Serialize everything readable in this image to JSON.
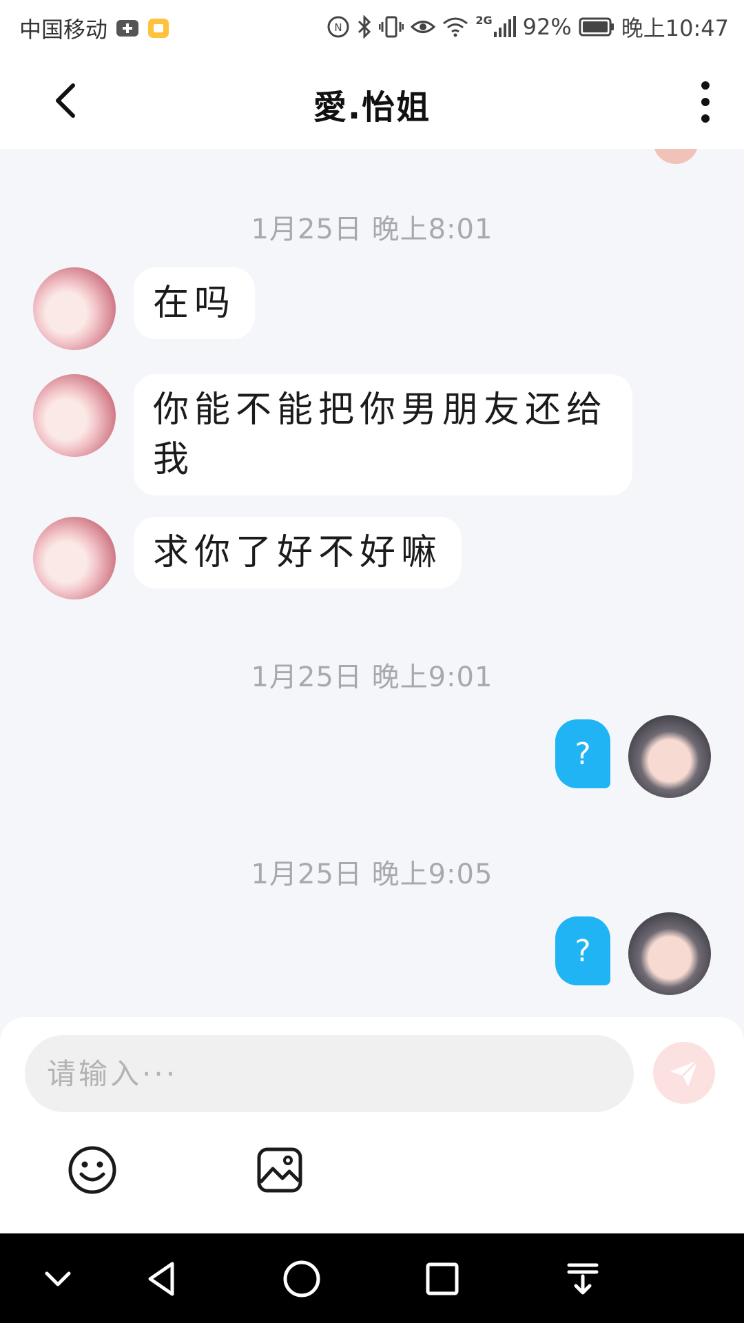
{
  "status_bar": {
    "carrier": "中国移动",
    "network": "2G",
    "battery": "92%",
    "time": "晚上10:47"
  },
  "header": {
    "title": "愛.怡姐"
  },
  "messages": {
    "timestamp_1": "1月25日 晚上8:01",
    "msg_1": "在吗",
    "msg_2": "你能不能把你男朋友还给我",
    "msg_3": "求你了好不好嘛",
    "timestamp_2": "1月25日 晚上9:01",
    "reply_1": "?",
    "timestamp_3": "1月25日 晚上9:05",
    "reply_2": "?"
  },
  "input": {
    "placeholder": "请输入···"
  },
  "colors": {
    "outgoing_bubble": "#20b4f5",
    "incoming_bubble": "#ffffff",
    "send_button": "#fbe1df",
    "chat_background": "#f4f6f9"
  },
  "icons": {
    "back": "chevron-left-icon",
    "more": "more-vertical-icon",
    "send": "paper-plane-icon",
    "emoji": "smiley-icon",
    "image": "image-icon"
  }
}
